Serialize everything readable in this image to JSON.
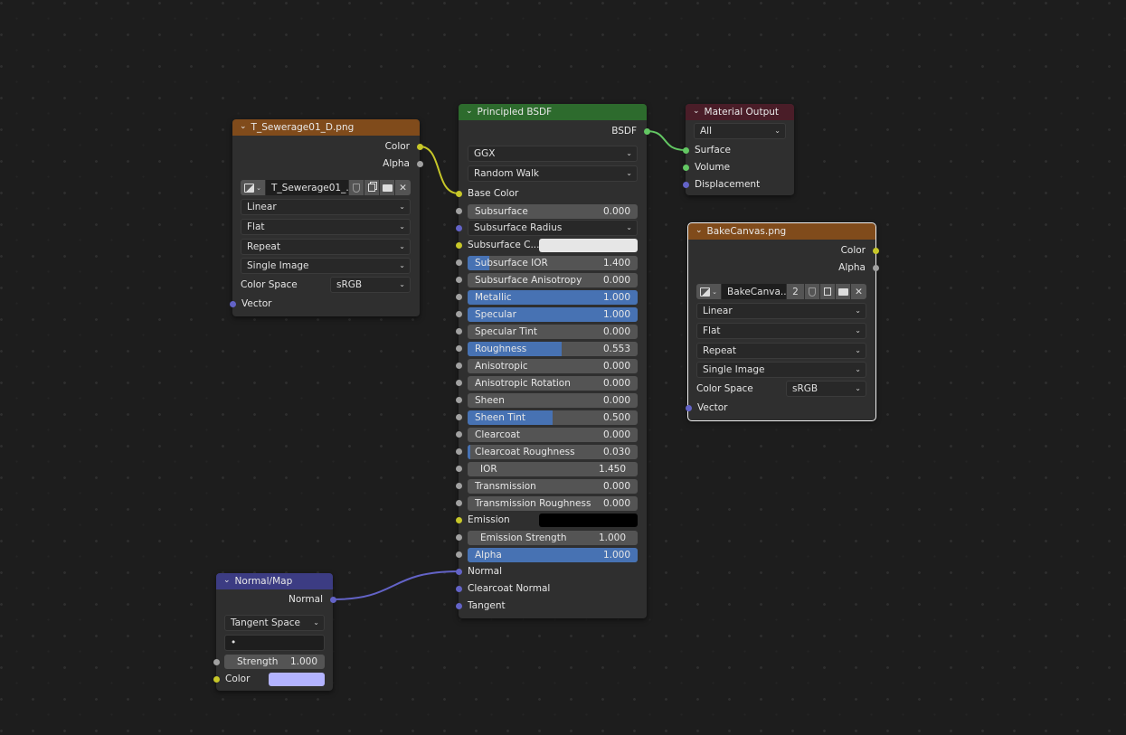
{
  "colors": {
    "image_header": "#804b1b",
    "shader_header": "#2d6b2d",
    "output_header": "#4a1d28",
    "vector_header": "#3c3c83",
    "slider_fill": "#4772b3",
    "link_yellow": "#c7c729",
    "link_green": "#63c763",
    "link_purple": "#6363c7"
  },
  "image_node_1": {
    "title": "T_Sewerage01_D.png",
    "outputs": [
      "Color",
      "Alpha"
    ],
    "image_name": "T_Sewerage01_...",
    "interpolation": "Linear",
    "projection": "Flat",
    "extension": "Repeat",
    "source": "Single Image",
    "color_space_label": "Color Space",
    "color_space": "sRGB",
    "input": "Vector"
  },
  "principled": {
    "title": "Principled BSDF",
    "output": "BSDF",
    "distribution": "GGX",
    "subsurface_method": "Random Walk",
    "base_color_label": "Base Color",
    "sliders": [
      {
        "name": "Subsurface",
        "value": "0.000",
        "fill": 0.0
      },
      {
        "name": "Subsurface Radius",
        "dropdown": true
      },
      {
        "name": "Subsurface C...",
        "color": "#e6e6e6"
      },
      {
        "name": "Subsurface IOR",
        "value": "1.400",
        "fill": 0.13
      },
      {
        "name": "Subsurface Anisotropy",
        "value": "0.000",
        "fill": 0.0
      },
      {
        "name": "Metallic",
        "value": "1.000",
        "fill": 1.0
      },
      {
        "name": "Specular",
        "value": "1.000",
        "fill": 1.0
      },
      {
        "name": "Specular Tint",
        "value": "0.000",
        "fill": 0.0
      },
      {
        "name": "Roughness",
        "value": "0.553",
        "fill": 0.553
      },
      {
        "name": "Anisotropic",
        "value": "0.000",
        "fill": 0.0
      },
      {
        "name": "Anisotropic Rotation",
        "value": "0.000",
        "fill": 0.0
      },
      {
        "name": "Sheen",
        "value": "0.000",
        "fill": 0.0
      },
      {
        "name": "Sheen Tint",
        "value": "0.500",
        "fill": 0.5
      },
      {
        "name": "Clearcoat",
        "value": "0.000",
        "fill": 0.0
      },
      {
        "name": "Clearcoat Roughness",
        "value": "0.030",
        "fill": 0.03
      },
      {
        "name": "IOR",
        "value": "1.450",
        "fill": 0.0
      },
      {
        "name": "Transmission",
        "value": "0.000",
        "fill": 0.0
      },
      {
        "name": "Transmission Roughness",
        "value": "0.000",
        "fill": 0.0
      },
      {
        "name": "Emission",
        "color": "#000000"
      },
      {
        "name": "Emission Strength",
        "value": "1.000",
        "fill": 0.0
      },
      {
        "name": "Alpha",
        "value": "1.000",
        "fill": 1.0
      }
    ],
    "vector_inputs": [
      "Normal",
      "Clearcoat Normal",
      "Tangent"
    ]
  },
  "material_output": {
    "title": "Material Output",
    "target": "All",
    "inputs": [
      "Surface",
      "Volume",
      "Displacement"
    ]
  },
  "image_node_2": {
    "title": "BakeCanvas.png",
    "outputs": [
      "Color",
      "Alpha"
    ],
    "image_name": "BakeCanva...",
    "users": "2",
    "interpolation": "Linear",
    "projection": "Flat",
    "extension": "Repeat",
    "source": "Single Image",
    "color_space_label": "Color Space",
    "color_space": "sRGB",
    "input": "Vector"
  },
  "normal_map": {
    "title": "Normal/Map",
    "output": "Normal",
    "space": "Tangent Space",
    "uv_map": "•",
    "strength_label": "Strength",
    "strength": "1.000",
    "color_label": "Color",
    "color": "#b3b3ff"
  }
}
